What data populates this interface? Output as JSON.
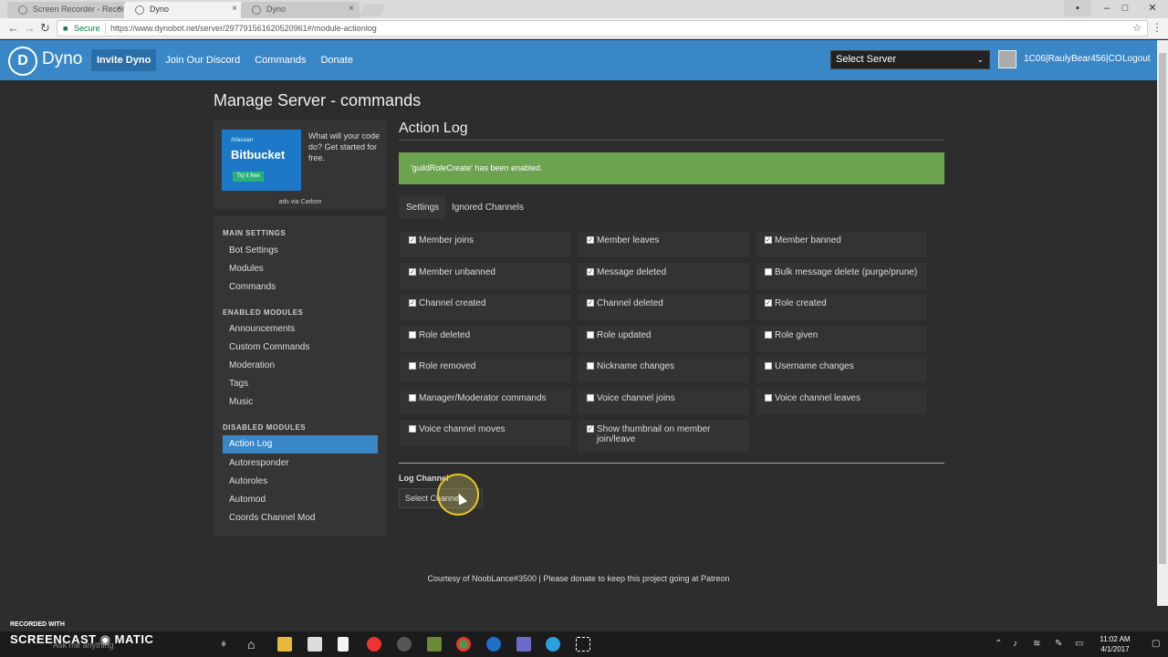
{
  "browser": {
    "tabs": [
      {
        "label": "Screen Recorder - Recor"
      },
      {
        "label": "Dyno"
      },
      {
        "label": "Dyno"
      }
    ],
    "secure_label": "Secure",
    "url": "https://www.dynobot.net/server/297791561620520961#/module-actionlog"
  },
  "navbar": {
    "logo_letter": "D",
    "brand": "Dyno",
    "links": [
      "Invite Dyno",
      "Join Our Discord",
      "Commands",
      "Donate"
    ],
    "server_select": "Select Server",
    "username": "1C06|RaulyBear456|CO",
    "logout": "Logout"
  },
  "page": {
    "title": "Manage Server - commands"
  },
  "ad": {
    "brand_small": "Atlassian",
    "brand": "Bitbucket",
    "button": "Try it free",
    "text": "What will your code do? Get started for free.",
    "via": "ads via Carbon"
  },
  "sidebar": {
    "main_heading": "MAIN SETTINGS",
    "main_items": [
      "Bot Settings",
      "Modules",
      "Commands"
    ],
    "enabled_heading": "ENABLED MODULES",
    "enabled_items": [
      "Announcements",
      "Custom Commands",
      "Moderation",
      "Tags",
      "Music"
    ],
    "disabled_heading": "DISABLED MODULES",
    "disabled_items": [
      "Action Log",
      "Autoresponder",
      "Autoroles",
      "Automod",
      "Coords Channel Mod"
    ]
  },
  "content": {
    "heading": "Action Log",
    "alert": "'guildRoleCreate' has been enabled.",
    "tabs": [
      "Settings",
      "Ignored Channels"
    ],
    "options": [
      {
        "label": "Member joins",
        "checked": true
      },
      {
        "label": "Member leaves",
        "checked": true
      },
      {
        "label": "Member banned",
        "checked": true
      },
      {
        "label": "Member unbanned",
        "checked": true
      },
      {
        "label": "Message deleted",
        "checked": true
      },
      {
        "label": "Bulk message delete (purge/prune)",
        "checked": false
      },
      {
        "label": "Channel created",
        "checked": true
      },
      {
        "label": "Channel deleted",
        "checked": true
      },
      {
        "label": "Role created",
        "checked": true
      },
      {
        "label": "Role deleted",
        "checked": false
      },
      {
        "label": "Role updated",
        "checked": false
      },
      {
        "label": "Role given",
        "checked": false
      },
      {
        "label": "Role removed",
        "checked": false
      },
      {
        "label": "Nickname changes",
        "checked": false
      },
      {
        "label": "Username changes",
        "checked": false
      },
      {
        "label": "Manager/Moderator commands",
        "checked": false
      },
      {
        "label": "Voice channel joins",
        "checked": false
      },
      {
        "label": "Voice channel leaves",
        "checked": false
      },
      {
        "label": "Voice channel moves",
        "checked": false
      },
      {
        "label": "Show thumbnail on member join/leave",
        "checked": true
      }
    ],
    "log_channel_label": "Log Channel",
    "log_channel_select": "Select Channel"
  },
  "footer": "Courtesy of NoobLance#3500 | Please donate to keep this project going at Patreon",
  "taskbar": {
    "watermark_top": "RECORDED WITH",
    "watermark_brand": "SCREENCAST ◉ MATIC",
    "search_placeholder": "Ask me anything",
    "time": "11:02 AM",
    "date": "4/1/2017"
  },
  "colors": {
    "accent": "#3a87c8",
    "alert_green": "#6ba34f",
    "background": "#2d2d2d"
  }
}
